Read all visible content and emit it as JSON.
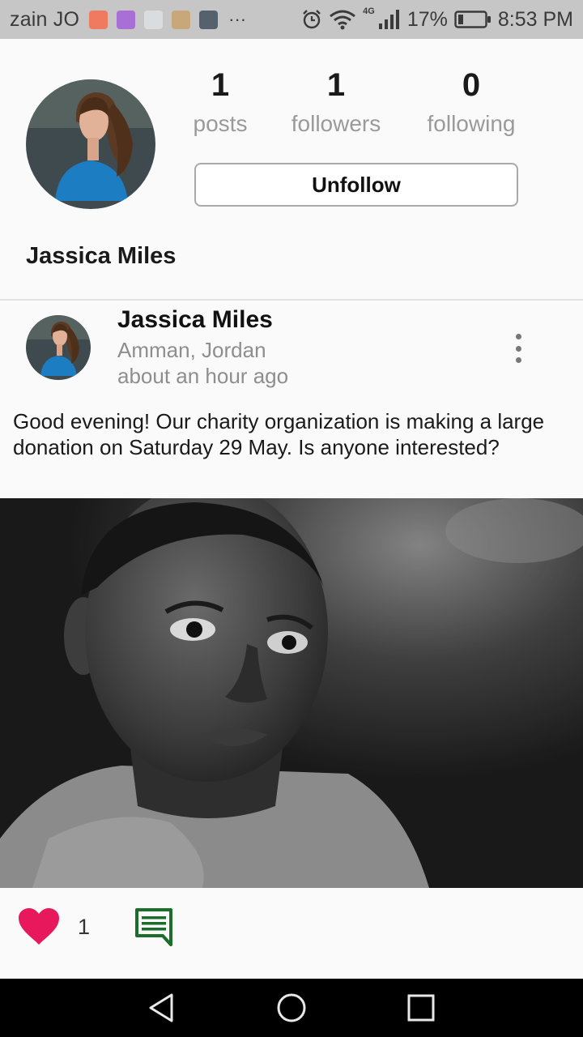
{
  "status_bar": {
    "carrier": "zain JO",
    "more": "···",
    "network": "4G",
    "battery": "17%",
    "time": "8:53 PM"
  },
  "profile": {
    "name": "Jassica Miles",
    "stats": {
      "posts": {
        "value": "1",
        "label": "posts"
      },
      "followers": {
        "value": "1",
        "label": "followers"
      },
      "following": {
        "value": "0",
        "label": "following"
      }
    },
    "unfollow_label": "Unfollow"
  },
  "post": {
    "author": "Jassica Miles",
    "location": "Amman, Jordan",
    "time": "about an hour ago",
    "text": "Good evening! Our charity organization is making a large donation on Saturday 29 May. Is anyone interested?",
    "likes": "1"
  },
  "icons": {
    "like": "heart-icon",
    "comment": "comment-icon",
    "more": "more-vertical-icon",
    "alarm": "alarm-icon",
    "wifi": "wifi-icon",
    "signal": "signal-icon",
    "battery": "battery-icon",
    "nav_back": "back-triangle-icon",
    "nav_home": "home-circle-icon",
    "nav_recent": "recent-square-icon"
  },
  "colors": {
    "status_bar_bg": "#c6c6c6",
    "like_heart": "#e8185c",
    "comment_icon": "#1b6e2a",
    "nav_bar_bg": "#000000",
    "muted_text": "#9a9a9a"
  }
}
